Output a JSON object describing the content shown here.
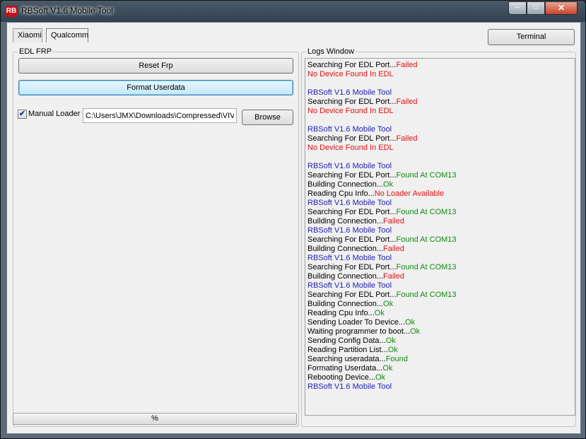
{
  "window": {
    "title": "RBSoft V1.6 Mobile Tool",
    "icon": "RB"
  },
  "tabs": [
    {
      "label": "Xiaomi"
    },
    {
      "label": "Qualcomm"
    }
  ],
  "terminal_label": "Terminal",
  "edl_group": {
    "title": "EDL FRP",
    "reset_frp_label": "Reset Frp",
    "format_userdata_label": "Format Userdata",
    "manual_loader_label": "Manual Loader",
    "manual_loader_checked": true,
    "loader_path": "C:\\Users\\JMX\\Downloads\\Compressed\\VIVO",
    "browse_label": "Browse"
  },
  "logs_group": {
    "title": "Logs Window"
  },
  "colors": {
    "info": "#1f1fb4",
    "error": "#e01010",
    "success": "#108a10",
    "normal": "#000000"
  },
  "logs": [
    [
      {
        "t": "Searching For EDL Port...",
        "c": "normal"
      },
      {
        "t": "Failed",
        "c": "error"
      }
    ],
    [
      {
        "t": "No Device Found In EDL",
        "c": "error"
      }
    ],
    [],
    [
      {
        "t": "RBSoft V1.6 Mobile Tool",
        "c": "info"
      }
    ],
    [
      {
        "t": "Searching For EDL Port...",
        "c": "normal"
      },
      {
        "t": "Failed",
        "c": "error"
      }
    ],
    [
      {
        "t": "No Device Found In EDL",
        "c": "error"
      }
    ],
    [],
    [
      {
        "t": "RBSoft V1.6 Mobile Tool",
        "c": "info"
      }
    ],
    [
      {
        "t": "Searching For EDL Port...",
        "c": "normal"
      },
      {
        "t": "Failed",
        "c": "error"
      }
    ],
    [
      {
        "t": "No Device Found In EDL",
        "c": "error"
      }
    ],
    [],
    [
      {
        "t": "RBSoft V1.6 Mobile Tool",
        "c": "info"
      }
    ],
    [
      {
        "t": "Searching For EDL Port...",
        "c": "normal"
      },
      {
        "t": "Found At COM13",
        "c": "success"
      }
    ],
    [
      {
        "t": "Building Connection...",
        "c": "normal"
      },
      {
        "t": "Ok",
        "c": "success"
      }
    ],
    [
      {
        "t": "Reading Cpu Info...",
        "c": "normal"
      },
      {
        "t": "No Loader Available",
        "c": "error"
      }
    ],
    [
      {
        "t": "RBSoft V1.6 Mobile Tool",
        "c": "info"
      }
    ],
    [
      {
        "t": "Searching For EDL Port...",
        "c": "normal"
      },
      {
        "t": "Found At COM13",
        "c": "success"
      }
    ],
    [
      {
        "t": "Building Connection...",
        "c": "normal"
      },
      {
        "t": "Failed",
        "c": "error"
      }
    ],
    [
      {
        "t": "RBSoft V1.6 Mobile Tool",
        "c": "info"
      }
    ],
    [
      {
        "t": "Searching For EDL Port...",
        "c": "normal"
      },
      {
        "t": "Found At COM13",
        "c": "success"
      }
    ],
    [
      {
        "t": "Building Connection...",
        "c": "normal"
      },
      {
        "t": "Failed",
        "c": "error"
      }
    ],
    [
      {
        "t": "RBSoft V1.6 Mobile Tool",
        "c": "info"
      }
    ],
    [
      {
        "t": "Searching For EDL Port...",
        "c": "normal"
      },
      {
        "t": "Found At COM13",
        "c": "success"
      }
    ],
    [
      {
        "t": "Building Connection...",
        "c": "normal"
      },
      {
        "t": "Failed",
        "c": "error"
      }
    ],
    [
      {
        "t": "RBSoft V1.6 Mobile Tool",
        "c": "info"
      }
    ],
    [
      {
        "t": "Searching For EDL Port...",
        "c": "normal"
      },
      {
        "t": "Found At COM13",
        "c": "success"
      }
    ],
    [
      {
        "t": "Building Connection...",
        "c": "normal"
      },
      {
        "t": "Ok",
        "c": "success"
      }
    ],
    [
      {
        "t": "Reading Cpu Info...",
        "c": "normal"
      },
      {
        "t": "Ok",
        "c": "success"
      }
    ],
    [
      {
        "t": "Sending Loader To Device...",
        "c": "normal"
      },
      {
        "t": "Ok",
        "c": "success"
      }
    ],
    [
      {
        "t": "Waiting programmer to boot...",
        "c": "normal"
      },
      {
        "t": "Ok",
        "c": "success"
      }
    ],
    [
      {
        "t": "Sending Config Data...",
        "c": "normal"
      },
      {
        "t": "Ok",
        "c": "success"
      }
    ],
    [
      {
        "t": "Reading Partition List...",
        "c": "normal"
      },
      {
        "t": "Ok",
        "c": "success"
      }
    ],
    [
      {
        "t": "Searching useradata...",
        "c": "normal"
      },
      {
        "t": "Found",
        "c": "success"
      }
    ],
    [
      {
        "t": "Formating Userdata...",
        "c": "normal"
      },
      {
        "t": "Ok",
        "c": "success"
      }
    ],
    [
      {
        "t": "Rebooting Device...",
        "c": "normal"
      },
      {
        "t": "Ok",
        "c": "success"
      }
    ],
    [
      {
        "t": "RBSoft V1.6 Mobile Tool",
        "c": "info"
      }
    ]
  ],
  "progress": {
    "label": "%",
    "value": 0
  }
}
